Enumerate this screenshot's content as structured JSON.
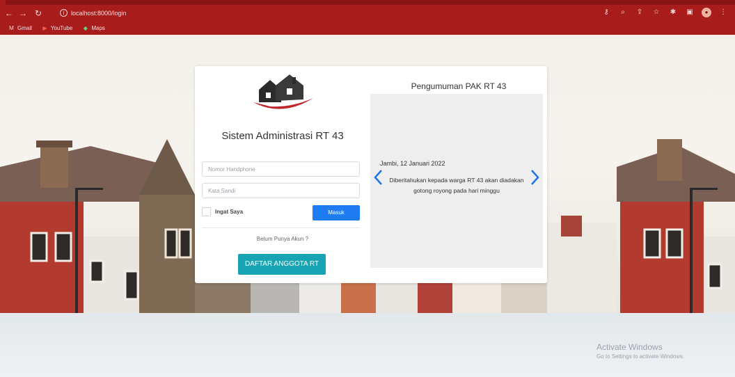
{
  "browser": {
    "url": "localhost:8000/login",
    "bookmarks": [
      {
        "label": "Gmail",
        "icon": "gmail-icon"
      },
      {
        "label": "YouTube",
        "icon": "youtube-icon"
      },
      {
        "label": "Maps",
        "icon": "maps-icon"
      }
    ]
  },
  "login": {
    "app_title": "Sistem Administrasi RT 43",
    "phone_placeholder": "Nomor Handphone",
    "password_placeholder": "Kata Sandi",
    "remember_label": "Ingat Saya",
    "login_button": "Masuk",
    "no_account_text": "Belum Punya Akun ?",
    "register_button": "DAFTAR ANGGOTA RT"
  },
  "announcement": {
    "title": "Pengumuman PAK RT 43",
    "date": "Jambi, 12 Januari 2022",
    "line1": "Diberitahukan kepada warga RT 43 akan diadakan",
    "line2": "gotong royong pada hari minggu"
  },
  "watermark": {
    "title": "Activate Windows",
    "subtitle": "Go to Settings to activate Windows."
  },
  "colors": {
    "chrome": "#a81c1c",
    "primary_button": "#1e7bf2",
    "register_button": "#19a4b3",
    "carousel_arrow": "#1a73e8"
  }
}
